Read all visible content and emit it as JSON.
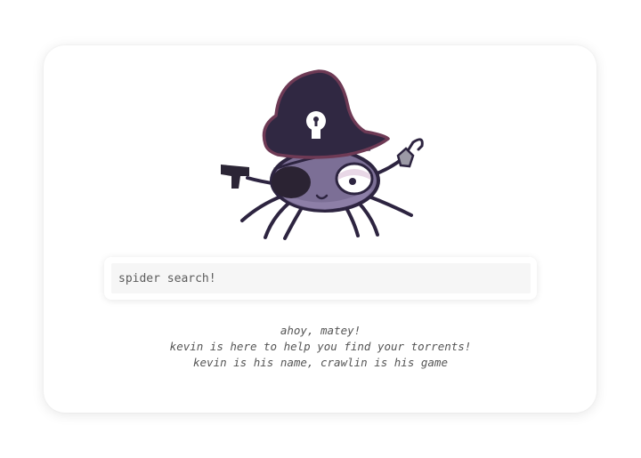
{
  "mascot": {
    "icon": "pirate-spider-icon",
    "hat_color": "#302842",
    "hat_trim_color": "#6e3a55",
    "body_color": "#7c6f96",
    "eye_highlight_color": "#e8d7e6"
  },
  "search": {
    "placeholder": "spider search!",
    "value": ""
  },
  "tagline": {
    "line1": "ahoy, matey!",
    "line2": "kevin is here to help you find your torrents!",
    "line3": "kevin is his name, crawlin is his game"
  }
}
